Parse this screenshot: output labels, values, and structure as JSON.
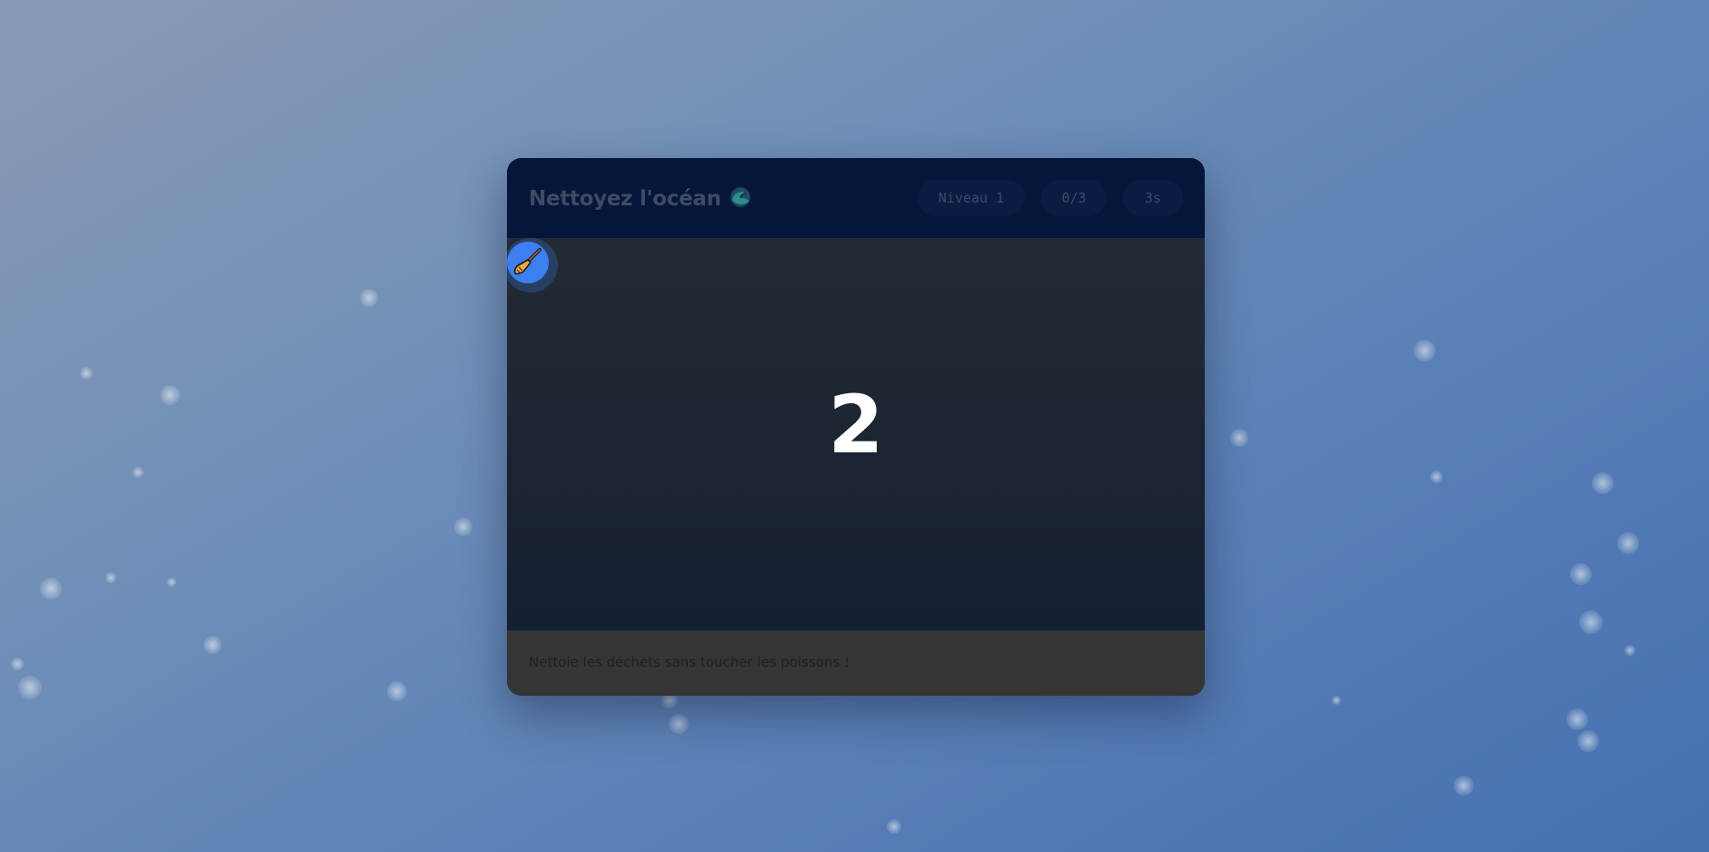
{
  "game": {
    "title": "Nettoyez l'océan",
    "title_icon": "wave-icon",
    "level_label": "Niveau 1",
    "score": "0/3",
    "timer": "3s",
    "countdown": "2",
    "tool_icon": "broom-icon",
    "instructions": "Nettoie les déchets sans toucher les poissons !"
  },
  "colors": {
    "header_bg": "#06163a",
    "tool_accent": "#3d7ef0",
    "footer_bg": "#353536"
  }
}
